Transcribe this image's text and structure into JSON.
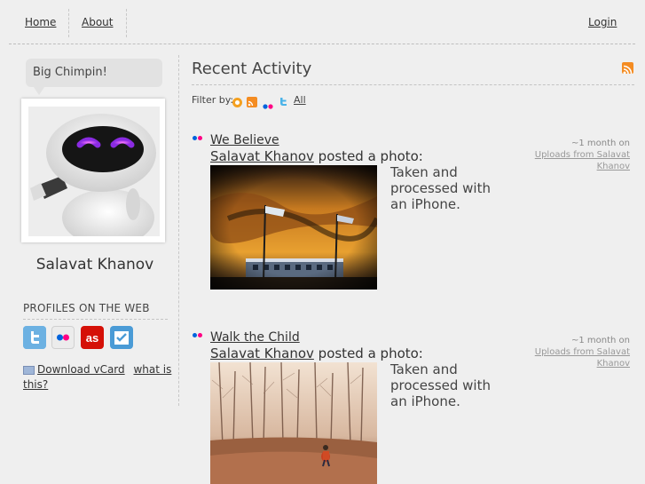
{
  "nav": {
    "home": "Home",
    "about": "About",
    "login": "Login"
  },
  "sidebar": {
    "bubble": "Big Chimpin!",
    "name": "Salavat Khanov",
    "profiles_heading": "PROFILES ON THE WEB",
    "profiles": [
      {
        "icon": "twitter-icon",
        "color": "#5ea9dd"
      },
      {
        "icon": "flickr-icon",
        "color": "#e8e8e8"
      },
      {
        "icon": "lastfm-icon",
        "color": "#d51007"
      },
      {
        "icon": "foursquare-icon",
        "color": "#3a8ec8"
      }
    ],
    "vcard": "Download vCard",
    "whatis": "what is this?"
  },
  "main": {
    "title": "Recent Activity",
    "filter_label": "Filter by:",
    "filter_all": "All",
    "entries": [
      {
        "title": "We Believe",
        "author": "Salavat Khanov",
        "action": "posted a photo:",
        "description": "Taken and processed with an iPhone.",
        "time": "~1 month on",
        "source": "Uploads from Salavat Khanov"
      },
      {
        "title": "Walk the Child",
        "author": "Salavat Khanov",
        "action": "posted a photo:",
        "description": "Taken and processed with an iPhone.",
        "time": "~1 month on",
        "source": "Uploads from Salavat Khanov"
      }
    ]
  },
  "colors": {
    "accent_rss": "#f48c22",
    "flickr_blue": "#0063dc",
    "flickr_pink": "#ff0084",
    "background": "#efefef"
  }
}
